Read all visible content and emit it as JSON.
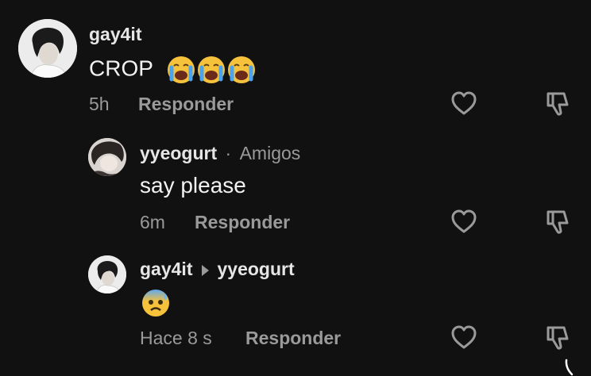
{
  "comments": [
    {
      "username": "gay4it",
      "text": "CROP",
      "emojis": [
        "loudly-crying-face",
        "loudly-crying-face",
        "loudly-crying-face"
      ],
      "time": "5h",
      "reply_label": "Responder"
    },
    {
      "username": "yyeogurt",
      "badge_separator": "·",
      "badge": "Amigos",
      "text": "say please",
      "time": "6m",
      "reply_label": "Responder"
    },
    {
      "username": "gay4it",
      "reply_to": "yyeogurt",
      "emojis": [
        "anxious-face-with-sweat"
      ],
      "time": "Hace 8 s",
      "reply_label": "Responder"
    }
  ],
  "colors": {
    "background": "#111111",
    "secondary_text": "#9a9a9a",
    "emoji_yellow": "#f7c23b"
  },
  "icons": [
    "heart-icon",
    "thumbs-down-icon"
  ]
}
